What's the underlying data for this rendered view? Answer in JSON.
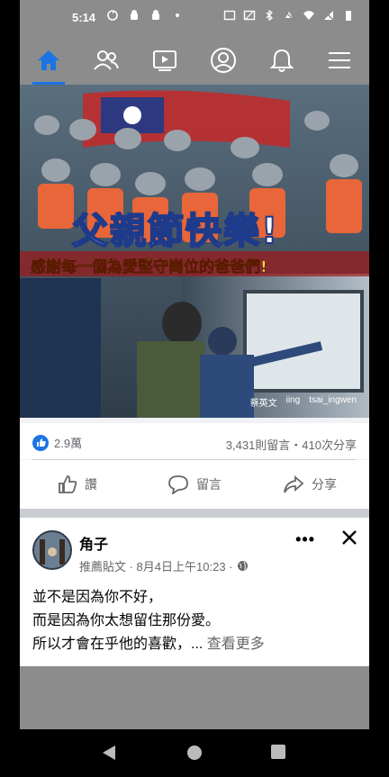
{
  "status_bar": {
    "time": "5:14"
  },
  "nav": {
    "items": [
      {
        "name": "home",
        "active": true
      },
      {
        "name": "friends",
        "active": false
      },
      {
        "name": "watch",
        "active": false
      },
      {
        "name": "profile",
        "active": false
      },
      {
        "name": "notifications",
        "active": false
      },
      {
        "name": "menu",
        "active": false
      }
    ]
  },
  "post_image": {
    "headline": "父親節快樂!",
    "subline": "感謝每一個為愛堅守崗位的爸爸們!",
    "credits": [
      "蔡英文",
      "iing",
      "tsai_ingwen"
    ]
  },
  "counts": {
    "likes": "2.9萬",
    "comments_shares": "3,431則留言・410次分享"
  },
  "actions": {
    "like": "讚",
    "comment": "留言",
    "share": "分享"
  },
  "second_post": {
    "author": "角子",
    "meta": "推薦貼文 · 8月4日上午10:23 ·",
    "text_lines": [
      "並不是因為你不好，",
      "而是因為你太想留住那份愛。",
      "所以才會在乎他的喜歡，..."
    ],
    "see_more": "查看更多"
  },
  "colors": {
    "accent": "#1b74e4",
    "overlay_gray": "#8c8c8c"
  }
}
